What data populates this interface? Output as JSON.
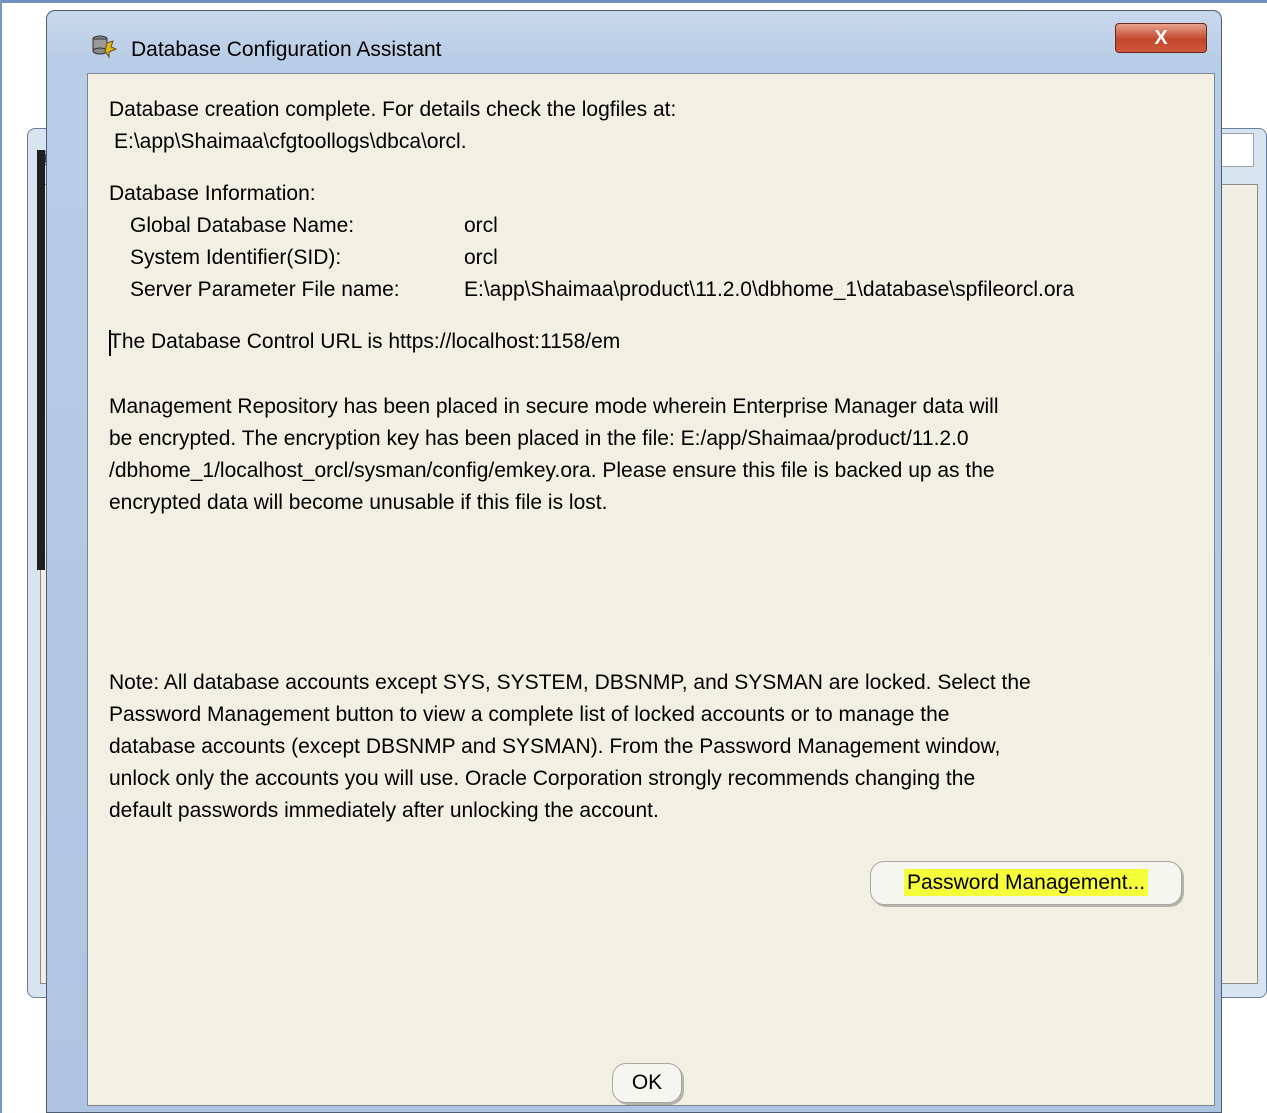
{
  "window": {
    "title": "Database Configuration Assistant",
    "close_label": "X"
  },
  "messages": {
    "complete_line1": "Database creation complete. For details check the logfiles at:",
    "complete_line2": "E:\\app\\Shaimaa\\cfgtoollogs\\dbca\\orcl.",
    "info_header": "Database Information:",
    "info_rows": [
      {
        "label": "Global Database Name:",
        "value": "orcl"
      },
      {
        "label": "System Identifier(SID):",
        "value": "orcl"
      },
      {
        "label": "Server Parameter File name:",
        "value": "E:\\app\\Shaimaa\\product\\11.2.0\\dbhome_1\\database\\spfileorcl.ora"
      }
    ],
    "control_url": "The Database Control URL is https://localhost:1158/em",
    "repository_lines": [
      "Management Repository has been placed in secure mode wherein Enterprise Manager data will",
      "be encrypted.  The encryption key has been placed in the file: E:/app/Shaimaa/product/11.2.0",
      "/dbhome_1/localhost_orcl/sysman/config/emkey.ora.   Please ensure this file is backed up as the",
      "encrypted data will become unusable if this file is lost."
    ],
    "note_lines": [
      "Note: All database accounts except SYS, SYSTEM, DBSNMP, and SYSMAN are locked. Select the",
      "Password Management button to view a complete list of locked accounts or to manage the",
      "database accounts (except DBSNMP and SYSMAN). From the Password Management window,",
      "unlock only the accounts you will use. Oracle Corporation strongly recommends changing the",
      "default passwords immediately after unlocking the account."
    ]
  },
  "buttons": {
    "password_management": "Password Management...",
    "ok": "OK"
  },
  "colors": {
    "highlight": "#f5ff3a",
    "content_bg": "#f1f0e3",
    "close_red": "#c0462a"
  }
}
